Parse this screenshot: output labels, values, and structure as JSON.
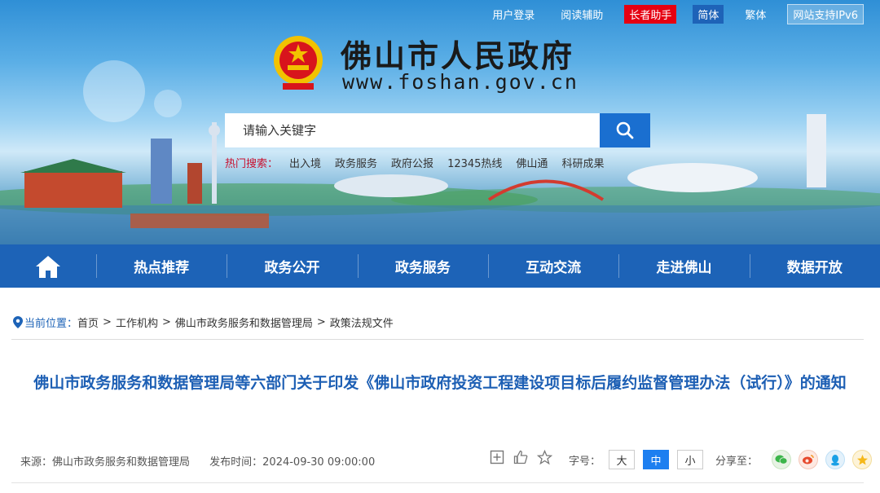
{
  "header": {
    "links": [
      "用户登录",
      "阅读辅助"
    ],
    "elder_mode": "长者助手",
    "lang_simplified": "简体",
    "lang_traditional": "繁体",
    "ipv6": "网站支持IPv6",
    "site_title": "佛山市人民政府",
    "site_url": "www.foshan.gov.cn",
    "search_placeholder": "请输入关键字",
    "hot_label": "热门搜索：",
    "hot_items": [
      "出入境",
      "政务服务",
      "政府公报",
      "12345热线",
      "佛山通",
      "科研成果"
    ]
  },
  "nav": {
    "items": [
      "热点推荐",
      "政务公开",
      "政务服务",
      "互动交流",
      "走进佛山",
      "数据开放"
    ]
  },
  "breadcrumb": {
    "label": "当前位置：",
    "items": [
      "首页",
      "工作机构",
      "佛山市政务服务和数据管理局",
      "政策法规文件"
    ]
  },
  "article": {
    "title": "佛山市政务服务和数据管理局等六部门关于印发《佛山市政府投资工程建设项目标后履约监督管理办法（试行）》的通知",
    "source": "来源：佛山市政务服务和数据管理局",
    "publish_time": "发布时间：2024-09-30 09:00:00"
  },
  "font_size": {
    "label": "字号：",
    "options": [
      "大",
      "中",
      "小"
    ],
    "selected": "中"
  },
  "share": {
    "label": "分享至："
  },
  "colors": {
    "nav_blue": "#1d63b7",
    "title_blue": "#1d5fb4",
    "elder_red": "#e60012",
    "hot_red": "#c8102e"
  }
}
